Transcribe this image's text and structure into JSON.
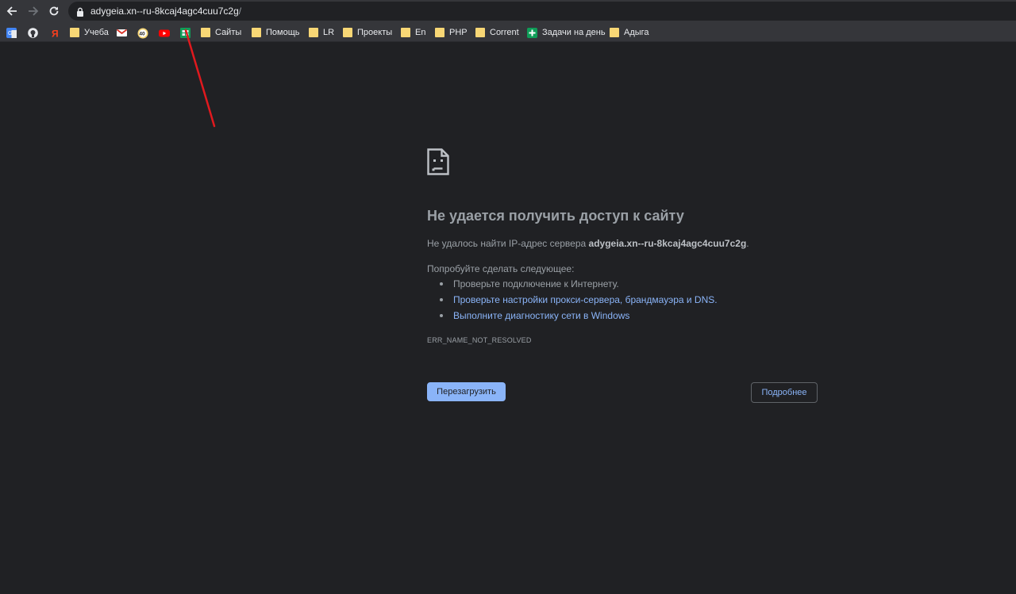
{
  "browser": {
    "url_host": "adygeia.xn--ru-8kcaj4agc4cuu7c2g",
    "url_path": "/",
    "nav_icons": [
      "back-icon",
      "forward-icon",
      "reload-icon",
      "lock-icon"
    ]
  },
  "bookmarks": [
    {
      "label": "",
      "icon": "google-translate-icon"
    },
    {
      "label": "",
      "icon": "github-icon"
    },
    {
      "label": "",
      "icon": "yandex-icon"
    },
    {
      "label": "Учеба",
      "icon": "folder-icon"
    },
    {
      "label": "",
      "icon": "gmail-icon"
    },
    {
      "label": "",
      "icon": "badge-40-icon",
      "badge": "40"
    },
    {
      "label": "",
      "icon": "youtube-icon"
    },
    {
      "label": "",
      "icon": "sheets-icon"
    },
    {
      "label": "Сайты",
      "icon": "folder-icon"
    },
    {
      "label": "Помощь",
      "icon": "folder-icon"
    },
    {
      "label": "LR",
      "icon": "folder-icon"
    },
    {
      "label": "Проекты",
      "icon": "folder-icon"
    },
    {
      "label": "En",
      "icon": "folder-icon"
    },
    {
      "label": "PHP",
      "icon": "folder-icon"
    },
    {
      "label": "Corrent",
      "icon": "folder-icon"
    },
    {
      "label": "Задачи на день",
      "icon": "tasks-plus-icon"
    },
    {
      "label": "Адыга",
      "icon": "folder-icon"
    }
  ],
  "error": {
    "icon": "sad-page-icon",
    "title": "Не удается получить доступ к сайту",
    "description_prefix": "Не удалось найти IP-адрес сервера ",
    "description_host": "adygeia.xn--ru-8kcaj4agc4cuu7c2g",
    "description_suffix": ".",
    "try_heading": "Попробуйте сделать следующее:",
    "suggestions": [
      {
        "text": "Проверьте подключение к Интернету.",
        "link": false
      },
      {
        "text": "Проверьте настройки прокси-сервера, брандмауэра и DNS.",
        "link": true
      },
      {
        "text": "Выполните диагностику сети в Windows",
        "link": true
      }
    ],
    "code": "ERR_NAME_NOT_RESOLVED",
    "reload_label": "Перезагрузить",
    "details_label": "Подробнее"
  },
  "colors": {
    "background": "#202124",
    "toolbar": "#35363a",
    "link": "#8ab4f8",
    "annotation_arrow": "#e0191e"
  }
}
